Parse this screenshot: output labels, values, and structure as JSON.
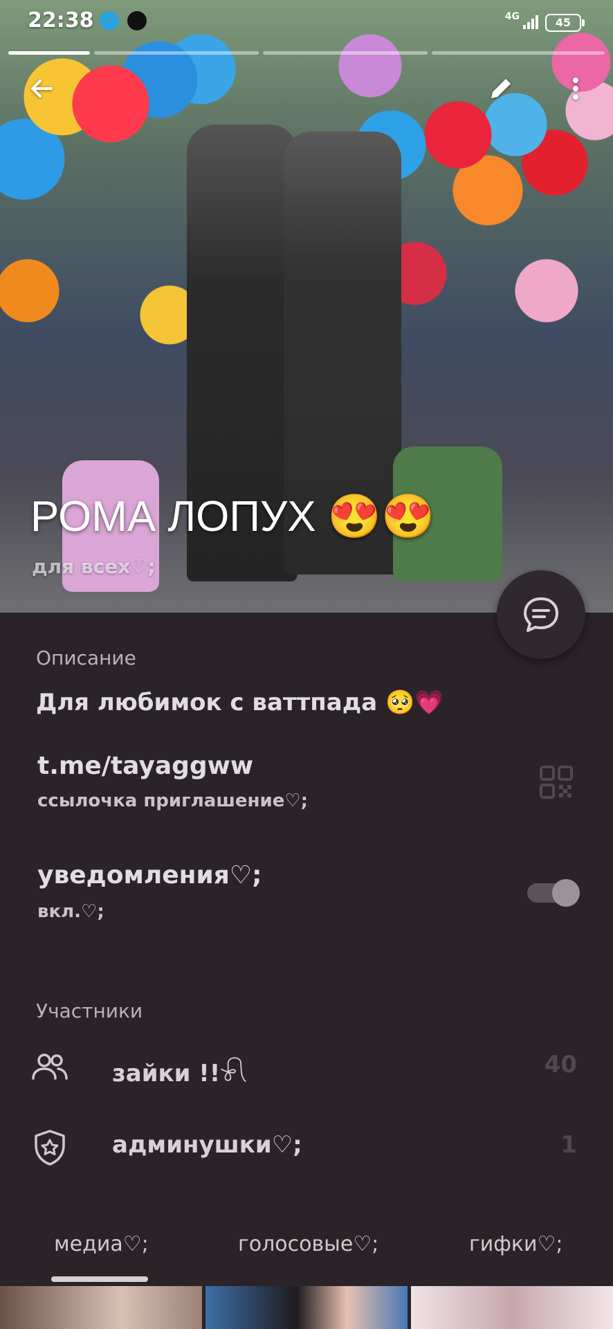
{
  "status_bar": {
    "time": "22:38",
    "network": "4G",
    "battery": "45"
  },
  "header": {
    "title": "РОМА ЛОПУХ 😍😍",
    "subtitle": "для всех♡;"
  },
  "info": {
    "description_heading": "Описание",
    "description": "Для любимок с ваттпада 🥺💗",
    "link": "t.me/tayaggww",
    "link_caption": "ссылочка приглашение♡;",
    "notifications_label": "уведомления♡;",
    "notifications_state": "вкл.♡;",
    "notifications_on": true
  },
  "members": {
    "heading": "Участники",
    "rows": [
      {
        "label": "зайки !!𓍯",
        "count": "40",
        "icon": "people-icon"
      },
      {
        "label": "админушки♡;",
        "count": "1",
        "icon": "shield-star-icon"
      }
    ]
  },
  "tabs": [
    {
      "label": "медиа♡;",
      "active": true
    },
    {
      "label": "голосовые♡;",
      "active": false
    },
    {
      "label": "гифки♡;",
      "active": false
    }
  ],
  "colors": {
    "background": "#2a2328",
    "fab": "#2f282d",
    "accent_text": "#e2dde0"
  }
}
